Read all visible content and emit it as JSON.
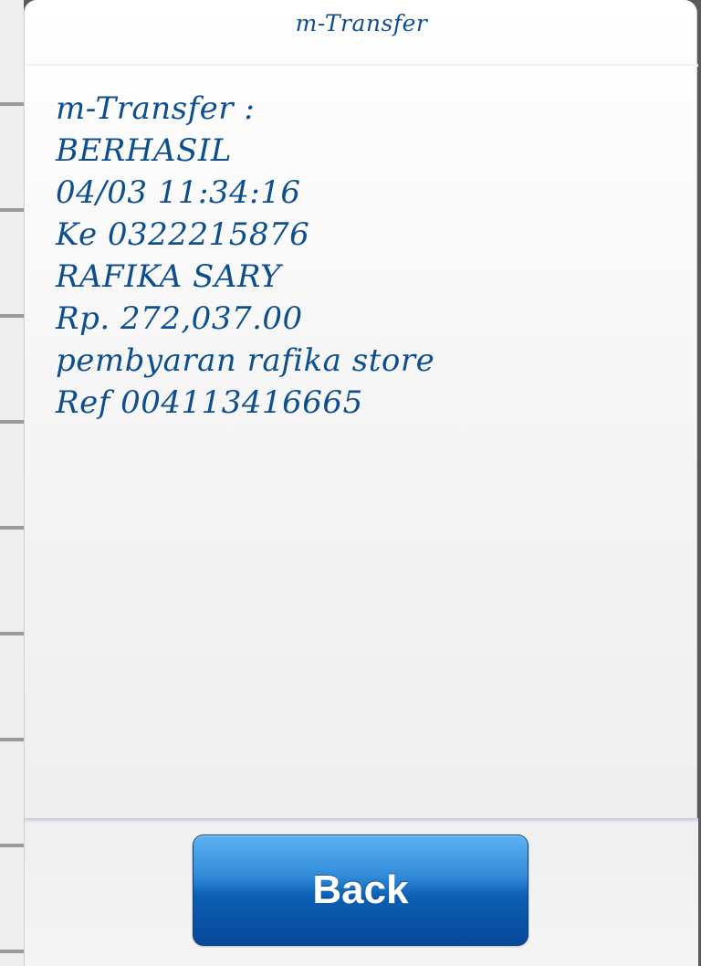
{
  "dialog": {
    "title": "m-Transfer"
  },
  "message": {
    "lines": [
      "m-Transfer :",
      "BERHASIL",
      "04/03 11:34:16",
      "Ke 0322215876",
      "RAFIKA SARY",
      "Rp. 272,037.00",
      "pembyaran rafika store",
      "Ref 004113416665"
    ]
  },
  "buttons": {
    "back_label": "Back"
  },
  "colors": {
    "text": "#0d4e8f",
    "button_top": "#5db2ef",
    "button_bottom": "#07489a"
  }
}
